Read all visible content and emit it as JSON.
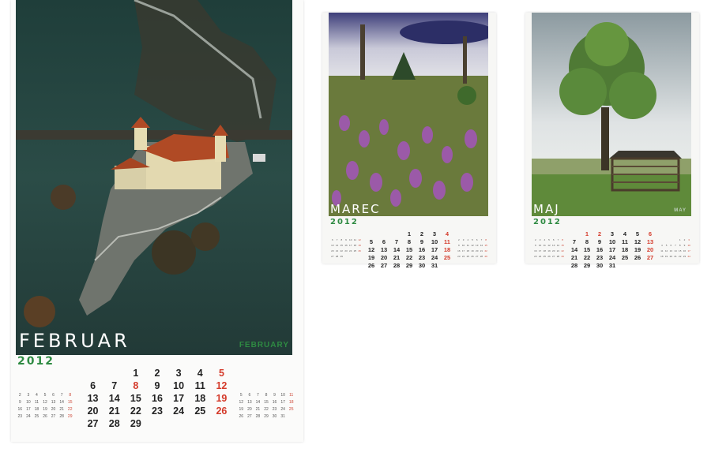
{
  "calendars": {
    "february": {
      "title": "FEBRUAR",
      "title_en": "FEBRUARY",
      "year": "2012",
      "days_row1": [
        "",
        "",
        "1",
        "2",
        "3",
        "4",
        "5"
      ],
      "days_row2": [
        "6",
        "7",
        "8",
        "9",
        "10",
        "11",
        "12"
      ],
      "days_row3": [
        "13",
        "14",
        "15",
        "16",
        "17",
        "18",
        "19"
      ],
      "days_row4": [
        "20",
        "21",
        "22",
        "23",
        "24",
        "25",
        "26"
      ],
      "days_row5": [
        "27",
        "28",
        "29",
        "",
        "",
        "",
        ""
      ]
    },
    "march": {
      "title": "MAREC",
      "year": "2012",
      "days_row1": [
        "",
        "",
        "",
        "1",
        "2",
        "3",
        "4"
      ],
      "days_row2": [
        "5",
        "6",
        "7",
        "8",
        "9",
        "10",
        "11"
      ],
      "days_row3": [
        "12",
        "13",
        "14",
        "15",
        "16",
        "17",
        "18"
      ],
      "days_row4": [
        "19",
        "20",
        "21",
        "22",
        "23",
        "24",
        "25"
      ],
      "days_row5": [
        "26",
        "27",
        "28",
        "29",
        "30",
        "31",
        ""
      ]
    },
    "may": {
      "title": "MAJ",
      "title_en": "MAY",
      "year": "2012",
      "days_row1": [
        "",
        "1",
        "2",
        "3",
        "4",
        "5",
        "6"
      ],
      "days_row2": [
        "7",
        "8",
        "9",
        "10",
        "11",
        "12",
        "13"
      ],
      "days_row3": [
        "14",
        "15",
        "16",
        "17",
        "18",
        "19",
        "20"
      ],
      "days_row4": [
        "21",
        "22",
        "23",
        "24",
        "25",
        "26",
        "27"
      ],
      "days_row5": [
        "28",
        "29",
        "30",
        "31",
        "",
        "",
        ""
      ]
    }
  },
  "colors": {
    "accent_green": "#2e8a42",
    "sunday_red": "#d43a2a"
  }
}
